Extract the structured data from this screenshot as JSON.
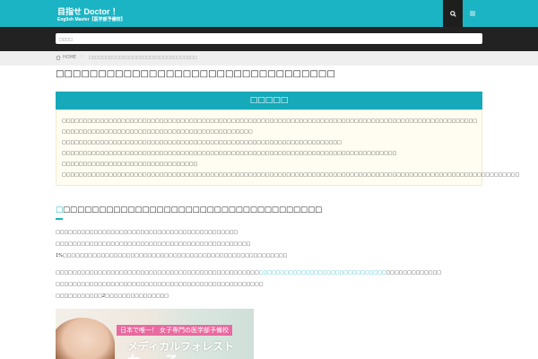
{
  "header": {
    "site_title": "目指せ Doctor ！",
    "site_subtitle": "English Master【医学部予備校】",
    "search_icon": "search-icon",
    "menu_icon": "menu-icon"
  },
  "search": {
    "placeholder": "□□□□"
  },
  "breadcrumb": {
    "home_label": "HOME",
    "separator": "›",
    "current": "□□□□□□□□□□□□□□□□□□□□□□□□□□□□□□□□"
  },
  "article": {
    "title": "□□□□□□□□□□□□□□□□□□□□□□□□□□□□□□□□□"
  },
  "toc": {
    "heading": "□□□□□",
    "items": [
      "□□□□□□□□□□□□□□□□□□□□□□□□□□□□□□□□□□□□□□□□□□□□□□□□□□□□□□□□□□□□□□□□□□□□□□□□□□□□□□□□□□□□□□□□□□□□□□□□□□",
      "□□□□□□□□□□□□□□□□□□□□□□□□□□□□□□□□□□□□□□□□□□□□□",
      "□□□□□□□□□□□□□□□□□□□□□□□□□□□□□□□□□□□□□□□□□□□□□□□□□□□□□□□□□□□□□□□□□□",
      "□□□□□□□□□□□□□□□□□□□□□□□□□□□□□□□□□□□□□□□□□□□□□□□□□□□□□□□□□□□□□□□□□□□□□□□□□□□□□□□",
      "□□□□□□□□□□□□□□□□□□□□□□□□□□□□□□□□",
      "□□□□□□□□□□□□□□□□□□□□□□□□□□□□□□□□□□□□□□□□□□□□□□□□□□□□□□□□□□□□□□□□□□□□□□□□□□□□□□□□□□□□□□□□□□□□□□□□□□□□□□□□□□□□"
    ]
  },
  "section": {
    "heading_mark": "□",
    "heading": "□□□□□□□□□□□□□□□□□□□□□□□□□□□□□□□□□□□□",
    "para1": [
      "□□□□□□□□□□□□□□□□□□□□□□□□□□□□□□□□□□□□□□□□□□□",
      "□□□□□□□□□□□□□□□□□□□□□□□□□□□□□□□□□□□□□□□□□□□□□□",
      "1%□□□□□□□□□□□□□□□□□□□□□□□□□□□□□□□□□□□□□□□□□□□□□□□□□□□□□"
    ],
    "para2_before_link": "□□□□□□□□□□□□□□□□□□□□□□□□□□□□□□□□□□□□□□□□□□□□□□□□",
    "para2_link": "□□□□□□□□□□□□□□□□□□□□□□□□□□□□□□",
    "para2_after_link": "□□□□□□□□□□□□□",
    "para2_rest": [
      "□□□□□□□□□□□□□□□□□□□□□□□□□□□□□□□□□□□□□□□□□□□□□□□□□",
      "□□□□□□□□□□□2□□□□□□□□□□□□□□□"
    ]
  },
  "hero": {
    "tag": "日本で唯一！ 女子専門の医学部予備校",
    "title": "メディカルフォレスト",
    "title2": "女　　子"
  },
  "colors": {
    "accent": "#1bb4c4",
    "toc_header": "#16a9b9",
    "header_dark": "#222222",
    "toc_bg": "#fffdf1"
  }
}
